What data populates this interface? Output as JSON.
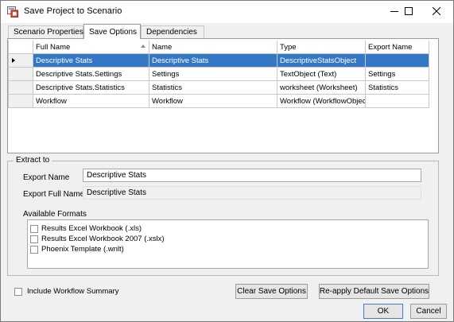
{
  "window": {
    "title": "Save Project to Scenario"
  },
  "tabs": [
    {
      "label": "Scenario Properties"
    },
    {
      "label": "Save Options"
    },
    {
      "label": "Dependencies"
    }
  ],
  "grid": {
    "columns": [
      "Full Name",
      "Name",
      "Type",
      "Export Name"
    ],
    "rows": [
      {
        "full_name": "Descriptive Stats",
        "name": "Descriptive Stats",
        "type": "DescriptiveStatsObject",
        "export_name": "",
        "selected": true
      },
      {
        "full_name": "Descriptive Stats.Settings",
        "name": "Settings",
        "type": "TextObject (Text)",
        "export_name": "Settings",
        "selected": false
      },
      {
        "full_name": "Descriptive Stats.Statistics",
        "name": "Statistics",
        "type": "worksheet (Worksheet)",
        "export_name": "Statistics",
        "selected": false
      },
      {
        "full_name": "Workflow",
        "name": "Workflow",
        "type": "Workflow (WorkflowObject)",
        "export_name": "",
        "selected": false
      }
    ]
  },
  "extract": {
    "group_title": "Extract to",
    "export_name_label": "Export Name",
    "export_name_value": "Descriptive Stats",
    "export_full_name_label": "Export Full Name",
    "export_full_name_value": "Descriptive Stats",
    "formats_label": "Available Formats",
    "formats": [
      {
        "label": "Results Excel Workbook (.xls)",
        "checked": false
      },
      {
        "label": "Results Excel Workbook 2007 (.xslx)",
        "checked": false
      },
      {
        "label": "Phoenix Template (.wnlt)",
        "checked": false
      }
    ]
  },
  "footer": {
    "include_summary_label": "Include Workflow Summary",
    "clear_button": "Clear Save Options",
    "reapply_button": "Re-apply Default Save Options",
    "ok_button": "OK",
    "cancel_button": "Cancel"
  },
  "icons": {
    "app": "save-project-icon",
    "minimize": "minimize-icon",
    "maximize": "maximize-icon",
    "close": "close-icon",
    "row_indicator": "row-pointer-icon",
    "sort": "sort-ascending-icon"
  },
  "colors": {
    "selection": "#3478c5",
    "window_bg": "#f0f0f0",
    "default_button_border": "#3c7fd1"
  }
}
